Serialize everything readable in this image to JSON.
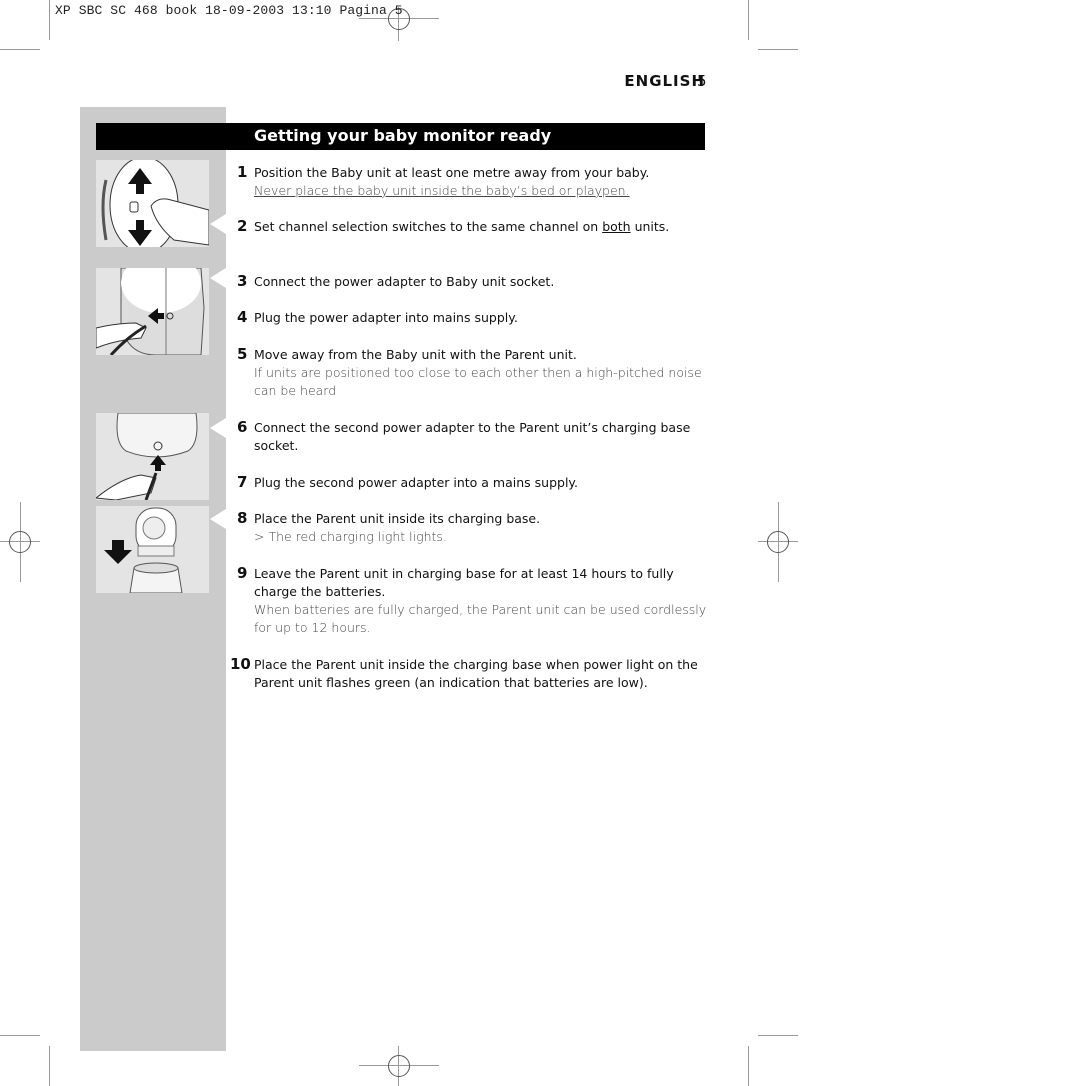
{
  "slug": "XP SBC SC 468 book  18-09-2003  13:10  Pagina 5",
  "header": {
    "language": "ENGLISH",
    "page_number": "5"
  },
  "section_title": "Getting your baby monitor ready",
  "steps": [
    {
      "num": "1",
      "text": "Position the Baby unit at least one metre away from your baby.",
      "note": "Never place the baby unit inside the baby’s bed or playpen."
    },
    {
      "num": "2",
      "text_before": "Set channel selection switches to the same channel on ",
      "emph": "both",
      "text_after": " units."
    },
    {
      "num": "3",
      "text": "Connect the power adapter to Baby unit socket."
    },
    {
      "num": "4",
      "text": "Plug the power adapter into mains supply."
    },
    {
      "num": "5",
      "text": "Move away from the Baby unit with the Parent unit.",
      "note": "If units are positioned too close to each other then a high-pitched noise can be heard"
    },
    {
      "num": "6",
      "text": "Connect the second power adapter to the Parent unit’s charging base socket."
    },
    {
      "num": "7",
      "text": "Plug the second power adapter into a mains supply."
    },
    {
      "num": "8",
      "text": "Place the Parent unit inside its charging base.",
      "note": "> The red charging light lights."
    },
    {
      "num": "9",
      "text": "Leave the Parent unit in charging base for at least 14 hours to fully charge the batteries.",
      "note": "When batteries are fully charged, the Parent unit can be used cordlessly for up to 12 hours."
    },
    {
      "num": "10",
      "text": "Place the Parent unit inside the charging base when power light on the Parent unit flashes green (an indication that batteries are low)."
    }
  ],
  "illustrations": [
    {
      "name": "channel-switch-illustration"
    },
    {
      "name": "baby-unit-adapter-illustration"
    },
    {
      "name": "charging-base-adapter-illustration"
    },
    {
      "name": "parent-unit-in-base-illustration"
    }
  ]
}
